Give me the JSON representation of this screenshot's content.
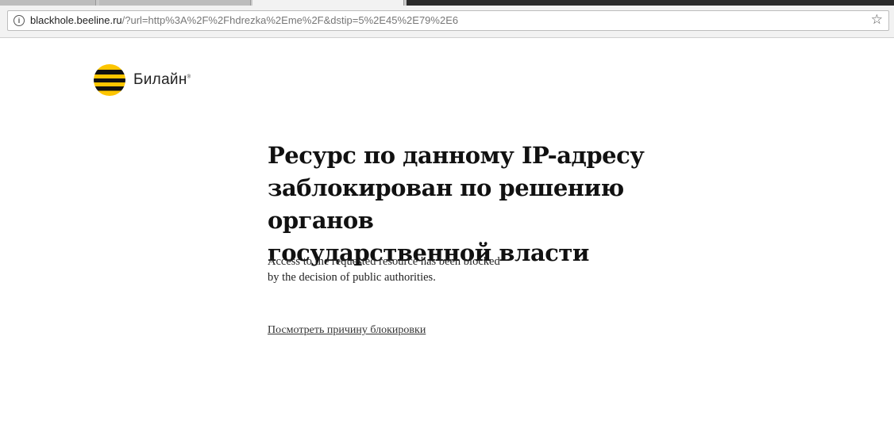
{
  "browser": {
    "url_host": "blackhole.beeline.ru",
    "url_path": "/?url=http%3A%2F%2Fhdrezka%2Eme%2F&dstip=5%2E45%2E79%2E6"
  },
  "logo": {
    "brand": "Билайн",
    "mark": "®",
    "colors": [
      "#fdc500",
      "#111111"
    ]
  },
  "main": {
    "title_lines": [
      "Ресурс по данному IP-адресу",
      "заблокирован по решению органов",
      "государственной власти"
    ],
    "desc_lines": [
      "Access to the requested resource has been blocked",
      "by the decision of public authorities."
    ],
    "reason_link": "Посмотреть причину блокировки"
  }
}
